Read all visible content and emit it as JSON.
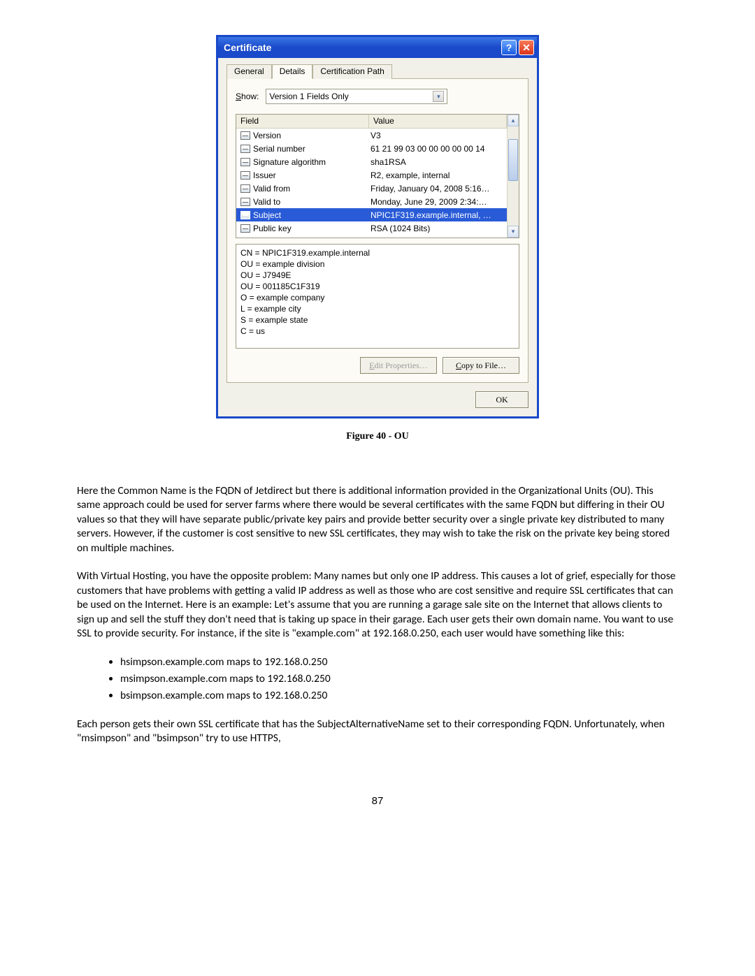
{
  "dialog": {
    "title": "Certificate",
    "tabs": [
      "General",
      "Details",
      "Certification Path"
    ],
    "active_tab_index": 1,
    "show_label": "Show:",
    "show_value": "Version 1 Fields Only",
    "columns": {
      "field": "Field",
      "value": "Value"
    },
    "rows": [
      {
        "field": "Version",
        "value": "V3"
      },
      {
        "field": "Serial number",
        "value": "61 21 99 03 00 00 00 00 00 14"
      },
      {
        "field": "Signature algorithm",
        "value": "sha1RSA"
      },
      {
        "field": "Issuer",
        "value": "R2, example, internal"
      },
      {
        "field": "Valid from",
        "value": "Friday, January 04, 2008 5:16…"
      },
      {
        "field": "Valid to",
        "value": "Monday, June 29, 2009 2:34:…"
      },
      {
        "field": "Subject",
        "value": "NPIC1F319.example.internal, …"
      },
      {
        "field": "Public key",
        "value": "RSA (1024 Bits)"
      }
    ],
    "selected_row_index": 6,
    "detail_lines": [
      "CN = NPIC1F319.example.internal",
      "OU = example division",
      "OU = J7949E",
      "OU = 001185C1F319",
      "O = example company",
      "L = example city",
      "S = example state",
      "C = us"
    ],
    "buttons": {
      "edit": "Edit Properties…",
      "copy": "Copy to File…",
      "ok": "OK"
    }
  },
  "caption": "Figure 40 - OU",
  "paragraphs": {
    "p1": "Here the Common Name is the FQDN of Jetdirect but there is additional information provided in the Organizational Units (OU).  This same approach could be used for server farms where there would be several certificates with the same FQDN but differing in their OU values so that they will have separate public/private key pairs and provide better security over a single private key distributed to many servers.  However, if the customer is cost sensitive to new SSL certificates, they may wish to take the risk on the private key being stored on multiple machines.",
    "p2": "With Virtual Hosting, you have the opposite problem: Many names but only one IP address.  This causes a lot of grief, especially for those customers that have problems with getting a valid IP address as well as those who are cost sensitive and require SSL certificates that can be used on the Internet.  Here is an example:  Let's assume that you are running a garage sale site on the Internet that allows clients to sign up and sell the stuff they don't need that is taking up space in their garage.  Each user gets their own domain name.  You want to use SSL to provide security.   For instance, if the site is \"example.com\" at 192.168.0.250, each user would have something like this:",
    "p3": "Each person gets their own SSL certificate that has the SubjectAlternativeName set to their corresponding FQDN.  Unfortunately, when \"msimpson\" and \"bsimpson\" try to use HTTPS,"
  },
  "bullets": [
    "hsimpson.example.com maps to 192.168.0.250",
    "msimpson.example.com maps to 192.168.0.250",
    "bsimpson.example.com maps to 192.168.0.250"
  ],
  "page_number": "87"
}
